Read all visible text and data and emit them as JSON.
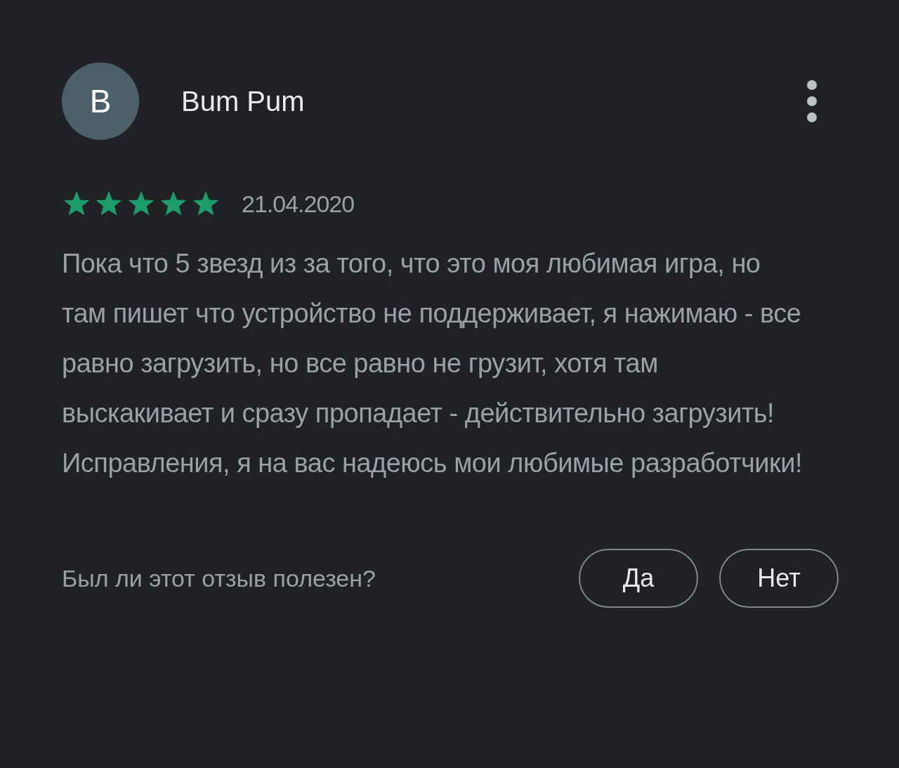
{
  "review": {
    "avatar_letter": "B",
    "author": "Bum Pum",
    "stars": 5,
    "date": "21.04.2020",
    "text": "Пока что 5 звезд из за того, что это моя любимая игра, но там пишет что устройство не поддерживает, я нажимаю - все равно загрузить, но все равно не грузит, хотя там выскакивает и сразу пропадает - действительно загрузить! Исправления, я на вас надеюсь мои любимые разработчики!"
  },
  "helpful": {
    "question": "Был ли этот отзыв полезен?",
    "buttons": [
      "Да",
      "Нет"
    ]
  }
}
